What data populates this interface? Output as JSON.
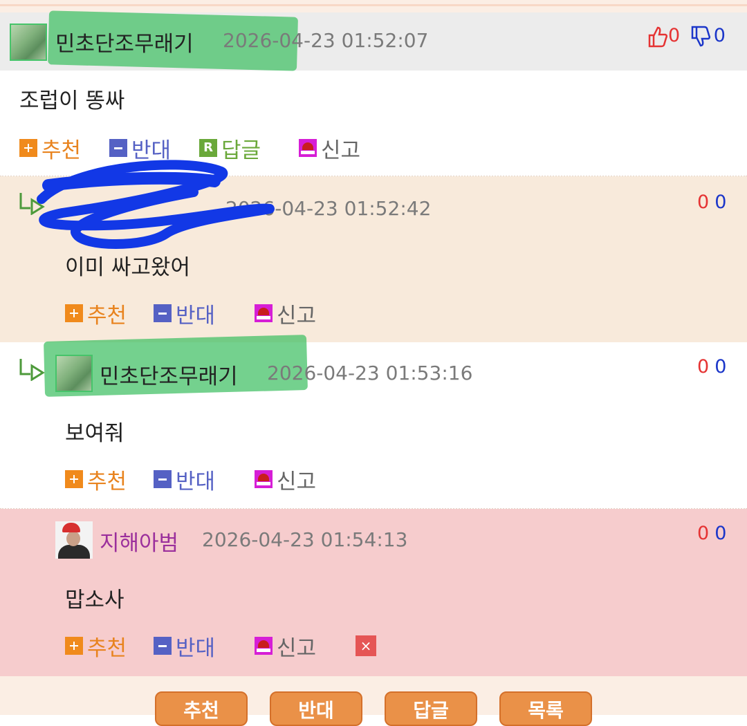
{
  "comments": [
    {
      "nick": "민초단조무래기",
      "time": "2026-04-23 01:52:07",
      "likes": "0",
      "dislikes": "0",
      "body": "조럽이 똥싸",
      "actions": {
        "recommend": "추천",
        "oppose": "반대",
        "reply": "답글",
        "reply_icon": "R",
        "report": "신고"
      }
    },
    {
      "nick": "",
      "time": "2026-04-23 01:52:42",
      "likes": "0",
      "dislikes": "0",
      "body": "이미 싸고왔어",
      "actions": {
        "recommend": "추천",
        "oppose": "반대",
        "report": "신고"
      }
    },
    {
      "nick": "민초단조무래기",
      "time": "2026-04-23 01:53:16",
      "likes": "0",
      "dislikes": "0",
      "body": "보여줘",
      "actions": {
        "recommend": "추천",
        "oppose": "반대",
        "report": "신고"
      }
    },
    {
      "nick": "지해아범",
      "time": "2026-04-23 01:54:13",
      "likes": "0",
      "dislikes": "0",
      "body": "맙소사",
      "actions": {
        "recommend": "추천",
        "oppose": "반대",
        "report": "신고",
        "delete_icon": "×"
      }
    }
  ],
  "bottom_buttons": [
    "추천",
    "반대",
    "답글",
    "목록"
  ],
  "colors": {
    "like": "#e53333",
    "dislike": "#1b36c9",
    "recommend": "#e8831e",
    "oppose": "#5561c4",
    "reply": "#6aa83a",
    "accent_button": "#ea9148"
  },
  "icons": [
    "thumbs-up-icon",
    "thumbs-down-icon",
    "plus-icon",
    "minus-icon",
    "reply-icon",
    "report-siren-icon",
    "delete-icon",
    "reply-arrow-icon"
  ]
}
